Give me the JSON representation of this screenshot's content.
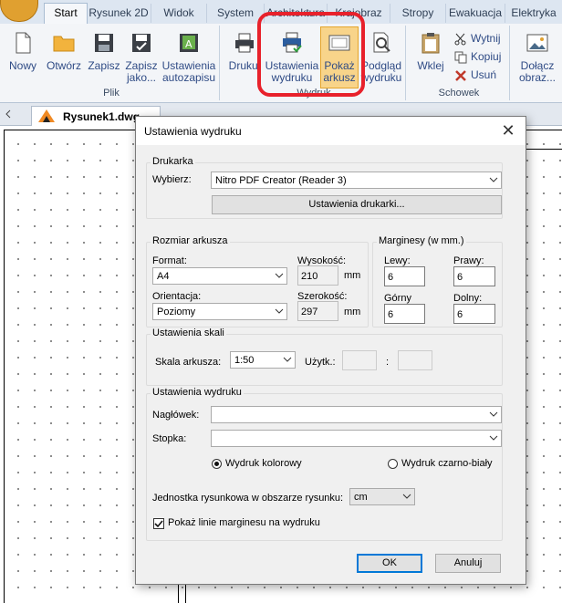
{
  "ribbon": {
    "tabs": [
      "Start",
      "Rysunek 2D",
      "Widok",
      "System",
      "Architektura",
      "Krajobraz",
      "Stropy",
      "Ewakuacja",
      "Elektryka"
    ],
    "active_tab": "Start",
    "groups": {
      "plik": {
        "label": "Plik",
        "buttons": {
          "nowy": "Nowy",
          "otworz": "Otwórz",
          "zapisz": "Zapisz",
          "zapisz_jako": "Zapisz\njako...",
          "autozapis": "Ustawienia\nautozapisu"
        }
      },
      "wydruk": {
        "label": "Wydruk",
        "buttons": {
          "drukuj": "Drukuj",
          "ustawienia": "Ustawienia\nwydruku",
          "pokaz": "Pokaż\narkusz",
          "podglad": "Podgląd\nwydruku"
        }
      },
      "schowek": {
        "label": "Schowek",
        "buttons": {
          "wklej": "Wklej",
          "wytnij": "Wytnij",
          "kopiuj": "Kopiuj",
          "usun": "Usuń"
        }
      },
      "dolacz": {
        "buttons": {
          "dolacz_obraz": "Dołącz\nobraz..."
        }
      }
    }
  },
  "document": {
    "tab_name": "Rysunek1.dwg"
  },
  "dialog": {
    "title": "Ustawienia wydruku",
    "printer": {
      "legend": "Drukarka",
      "select_label": "Wybierz:",
      "selected": "Nitro PDF Creator (Reader 3)",
      "settings_button": "Ustawienia drukarki..."
    },
    "sheet": {
      "legend": "Rozmiar arkusza",
      "format_label": "Format:",
      "format_value": "A4",
      "orientation_label": "Orientacja:",
      "orientation_value": "Poziomy",
      "height_label": "Wysokość:",
      "height_value": "210",
      "width_label": "Szerokość:",
      "width_value": "297",
      "unit": "mm"
    },
    "margins": {
      "legend": "Marginesy (w mm.)",
      "left_label": "Lewy:",
      "left_value": "6",
      "right_label": "Prawy:",
      "right_value": "6",
      "top_label": "Górny",
      "top_value": "6",
      "bottom_label": "Dolny:",
      "bottom_value": "6"
    },
    "scale": {
      "legend": "Ustawienia skali",
      "sheet_scale_label": "Skala arkusza:",
      "sheet_scale_value": "1:50",
      "user_label": "Użytk.:",
      "separator": ":"
    },
    "print_settings": {
      "legend": "Ustawienia wydruku",
      "header_label": "Nagłówek:",
      "footer_label": "Stopka:",
      "color_label": "Wydruk kolorowy",
      "bw_label": "Wydruk czarno-biały",
      "unit_label": "Jednostka rysunkowa w obszarze rysunku:",
      "unit_value": "cm",
      "show_margin_label": "Pokaż linie marginesu na wydruku"
    },
    "ok_label": "OK",
    "cancel_label": "Anuluj"
  },
  "colors": {
    "highlight_red": "#e8212b",
    "pressed_orange": "#f8d48a",
    "ribbon_text": "#2f4b85"
  }
}
